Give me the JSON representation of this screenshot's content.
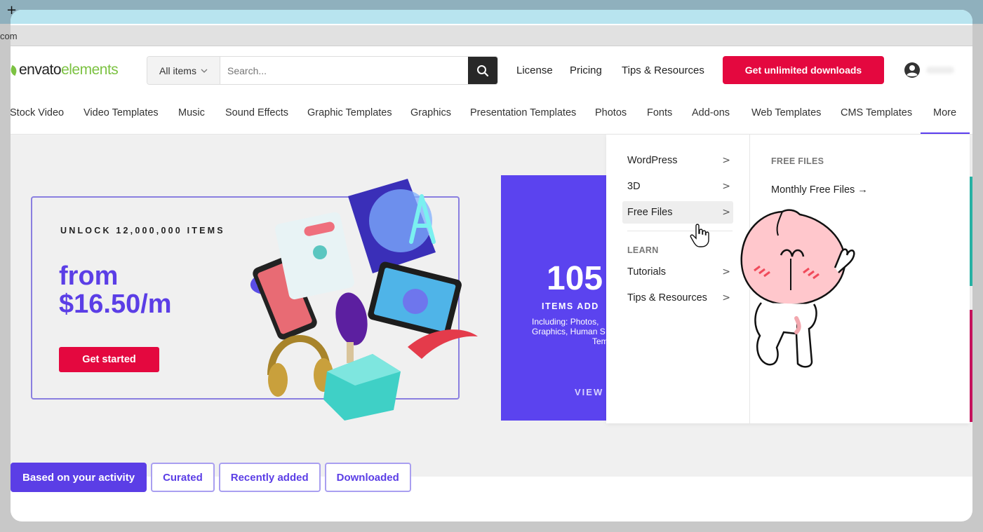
{
  "browser": {
    "new_tab": "+",
    "address_fragment": "com"
  },
  "header": {
    "logo": {
      "part1": "envato",
      "part2": "elements"
    },
    "search": {
      "category": "All items",
      "placeholder": "Search..."
    },
    "nav": [
      {
        "label": "License"
      },
      {
        "label": "Pricing"
      },
      {
        "label": "Tips & Resources"
      }
    ],
    "cta": "Get unlimited downloads"
  },
  "categories": [
    "Stock Video",
    "Video Templates",
    "Music",
    "Sound Effects",
    "Graphic Templates",
    "Graphics",
    "Presentation Templates",
    "Photos",
    "Fonts",
    "Add-ons",
    "Web Templates",
    "CMS Templates",
    "More"
  ],
  "hero": {
    "eyebrow": "UNLOCK 12,000,000 ITEMS",
    "price_line1": "from",
    "price_line2": "$16.50/m",
    "button": "Get started"
  },
  "promo": {
    "number": "105",
    "items": "ITEMS ADD",
    "including_line1": "Including: Photos,",
    "including_line2": "Graphics, Human S",
    "including_line3": "Tem",
    "view": "VIEW"
  },
  "dropdown": {
    "items": [
      {
        "label": "WordPress",
        "chevron": ">"
      },
      {
        "label": "3D",
        "chevron": ">"
      },
      {
        "label": "Free Files",
        "chevron": ">"
      }
    ],
    "learn_heading": "LEARN",
    "learn_items": [
      {
        "label": "Tutorials",
        "chevron": ">"
      },
      {
        "label": "Tips & Resources",
        "chevron": ">"
      }
    ],
    "free_files_heading": "FREE FILES",
    "free_files_link": "Monthly Free Files →"
  },
  "tabs": [
    {
      "label": "Based on your activity"
    },
    {
      "label": "Curated"
    },
    {
      "label": "Recently added"
    },
    {
      "label": "Downloaded"
    }
  ],
  "colors": {
    "brand_green": "#7cc242",
    "cta_red": "#e4083f",
    "accent_purple": "#5b3ee6"
  }
}
